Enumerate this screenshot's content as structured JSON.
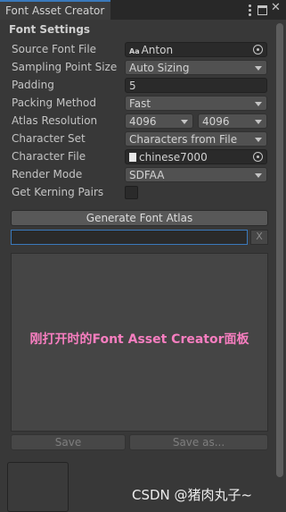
{
  "window": {
    "tab_title": "Font Asset Creator",
    "icons": [
      "kebab-menu-icon",
      "maximize-icon",
      "close-icon"
    ]
  },
  "section_title": "Font Settings",
  "settings": {
    "source_font_file": {
      "label": "Source Font File",
      "value": "Anton",
      "icon": "font-asset-icon"
    },
    "sampling_point_size": {
      "label": "Sampling Point Size",
      "value": "Auto Sizing"
    },
    "padding": {
      "label": "Padding",
      "value": "5"
    },
    "packing_method": {
      "label": "Packing Method",
      "value": "Fast"
    },
    "atlas_resolution": {
      "label": "Atlas Resolution",
      "width": "4096",
      "height": "4096"
    },
    "character_set": {
      "label": "Character Set",
      "value": "Characters from File"
    },
    "character_file": {
      "label": "Character File",
      "value": "chinese7000",
      "icon": "text-asset-icon"
    },
    "render_mode": {
      "label": "Render Mode",
      "value": "SDFAA"
    },
    "get_kerning_pairs": {
      "label": "Get Kerning Pairs",
      "checked": false
    }
  },
  "buttons": {
    "generate": "Generate Font Atlas",
    "clear": "X",
    "save": "Save",
    "save_as": "Save as..."
  },
  "preview_caption": "刚打开时的Font Asset Creator面板",
  "watermark": "CSDN @猪肉丸子~",
  "colors": {
    "accent": "#3a79bb",
    "panel_bg": "#383838",
    "caption": "#f77ec0"
  }
}
